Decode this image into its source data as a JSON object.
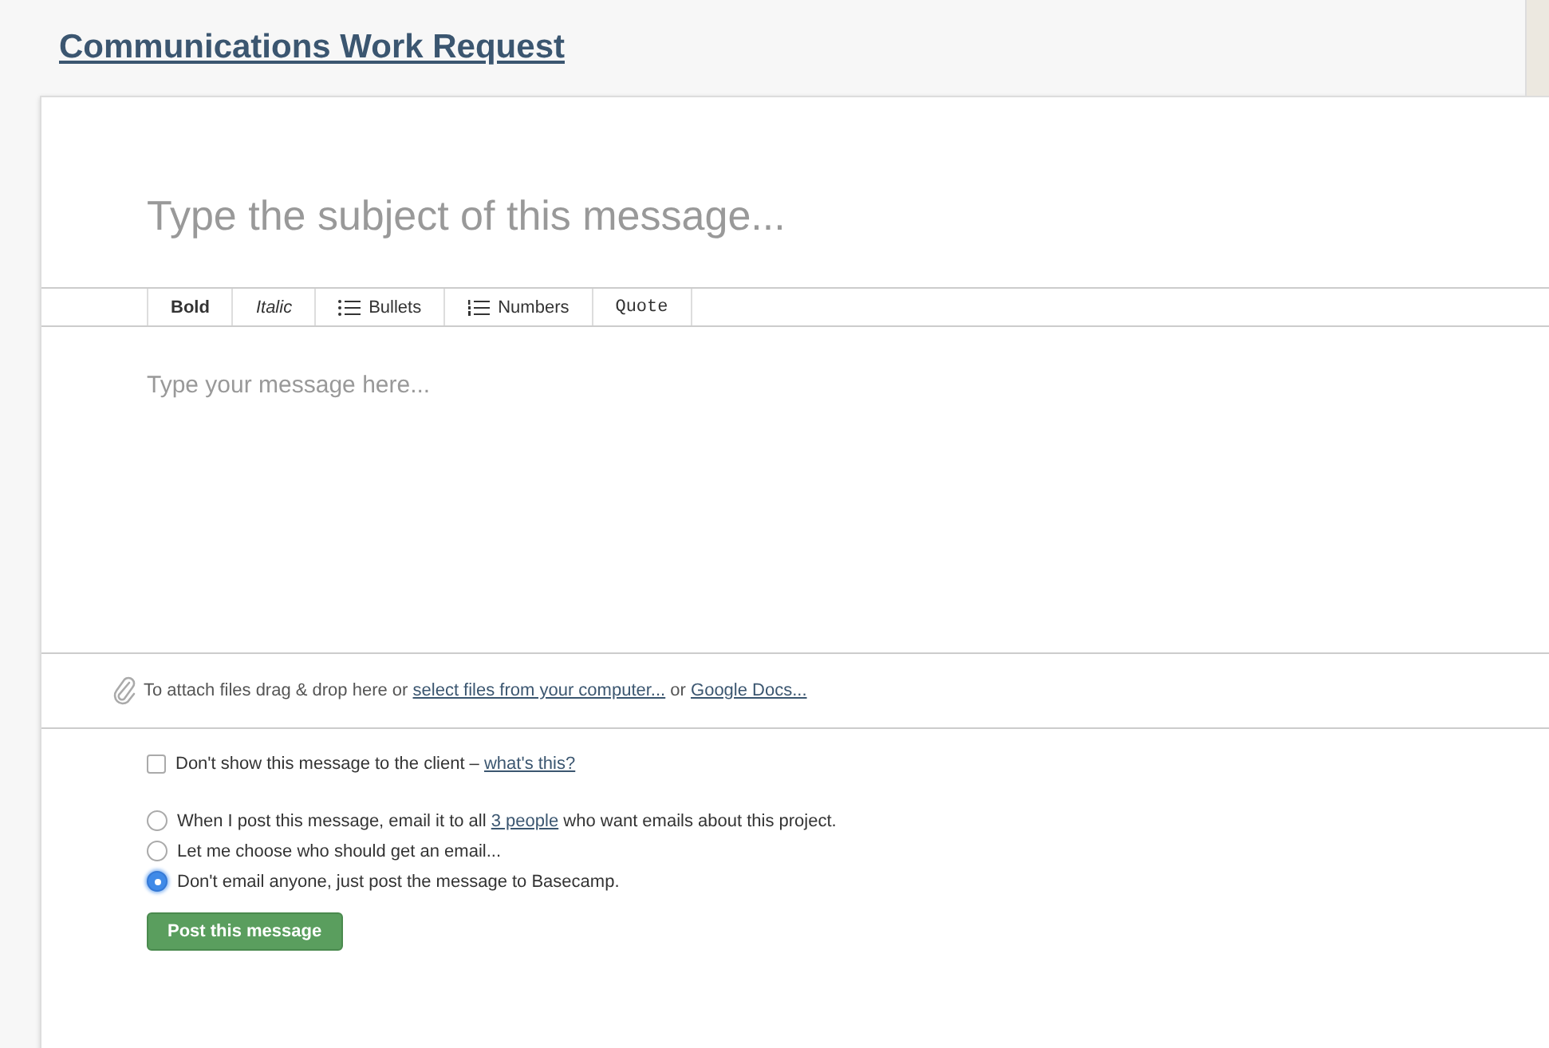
{
  "page": {
    "title": "Communications Work Request"
  },
  "subject": {
    "placeholder": "Type the subject of this message..."
  },
  "toolbar": [
    {
      "label": "Bold",
      "kind": "bold"
    },
    {
      "label": "Italic",
      "kind": "italic"
    },
    {
      "label": "Bullets",
      "kind": "bullets"
    },
    {
      "label": "Numbers",
      "kind": "numbers"
    },
    {
      "label": "Quote",
      "kind": "quote"
    }
  ],
  "body": {
    "placeholder": "Type your message here..."
  },
  "attach": [
    {
      "kind": "text",
      "text": "To attach files drag & drop here or "
    },
    {
      "kind": "link",
      "text": "select files from your computer..."
    },
    {
      "kind": "text",
      "text": " or "
    },
    {
      "kind": "link",
      "text": "Google Docs..."
    }
  ],
  "client_option": {
    "checked": false,
    "parts": [
      {
        "kind": "text",
        "text": "Don't show this message to the client – "
      },
      {
        "kind": "link",
        "text": "what's this?"
      }
    ]
  },
  "email_options": [
    {
      "selected": false,
      "parts": [
        {
          "kind": "text",
          "text": "When I post this message, email it to all "
        },
        {
          "kind": "link",
          "text": "3 people"
        },
        {
          "kind": "text",
          "text": " who want emails about this project."
        }
      ]
    },
    {
      "selected": false,
      "parts": [
        {
          "kind": "text",
          "text": "Let me choose who should get an email..."
        }
      ]
    },
    {
      "selected": true,
      "parts": [
        {
          "kind": "text",
          "text": "Don't email anyone, just post the message to Basecamp."
        }
      ]
    }
  ],
  "submit": {
    "label": "Post this message"
  }
}
